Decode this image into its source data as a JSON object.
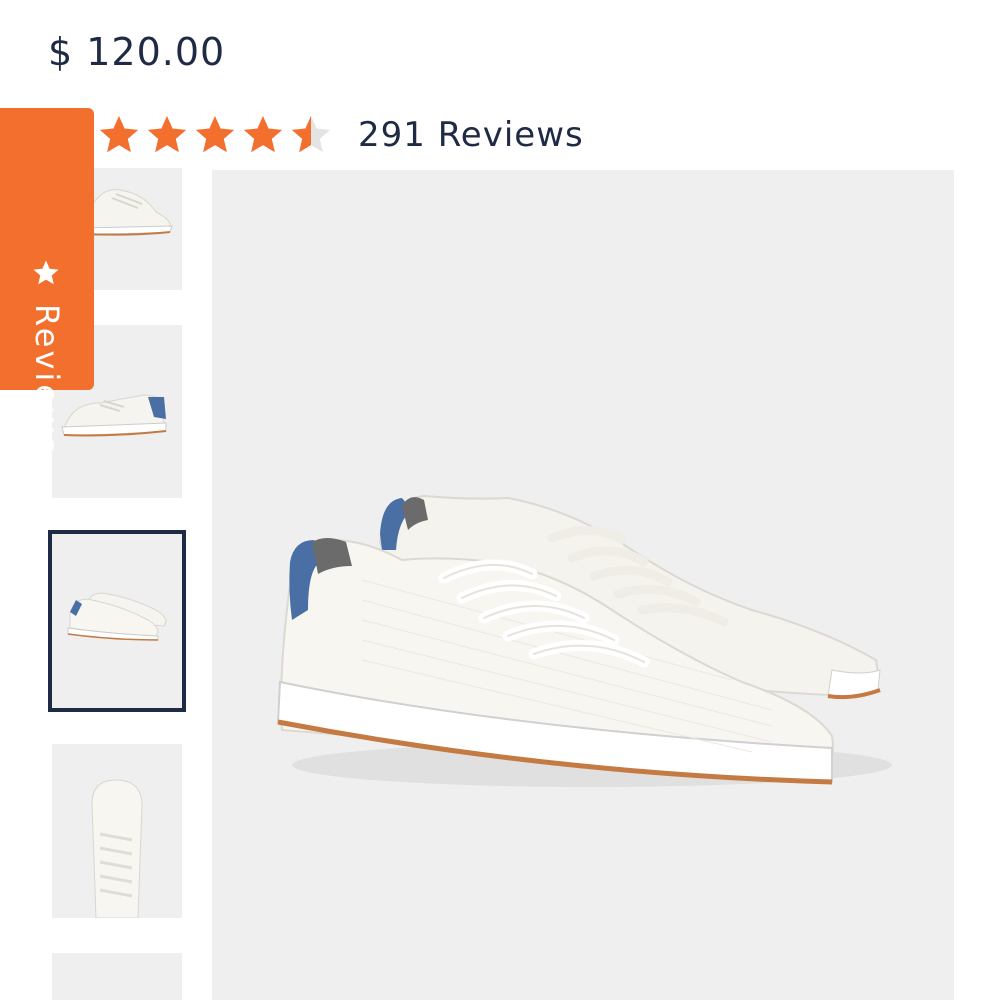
{
  "product": {
    "price": "$ 120.00",
    "rating": 4.5,
    "rating_max": 5,
    "reviews_count_label": "291 Reviews"
  },
  "reviews_tab": {
    "label": "Reviews",
    "icon": "star-icon"
  },
  "gallery": {
    "thumbnails": [
      {
        "name": "thumbnail-side-view",
        "selected": false
      },
      {
        "name": "thumbnail-back-side-view",
        "selected": false
      },
      {
        "name": "thumbnail-pair-view",
        "selected": true
      },
      {
        "name": "thumbnail-top-view",
        "selected": false
      },
      {
        "name": "thumbnail-extra-view",
        "selected": false
      }
    ],
    "main_image": "white-knit-sneakers-pair"
  },
  "colors": {
    "accent": "#f36f2d",
    "text": "#1f2a44",
    "image_bg": "#efefef",
    "shoe_heel": "#4a6fa5",
    "sole": "#c67a43"
  }
}
